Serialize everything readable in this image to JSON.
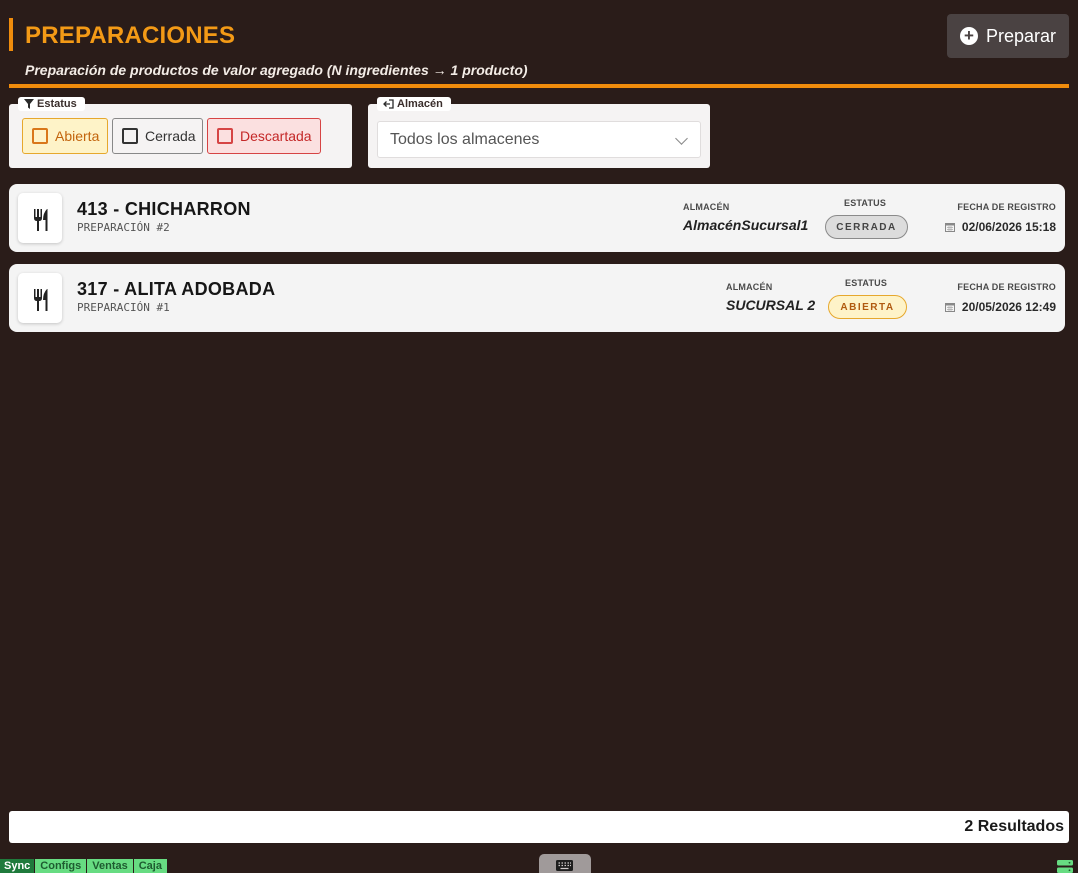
{
  "header": {
    "title": "PREPARACIONES",
    "subtitle": "Preparación de productos de valor agregado (N ingredientes → 1 producto)",
    "prepare_button": "Preparar"
  },
  "filters": {
    "status": {
      "legend": "Estatus",
      "options": [
        {
          "label": "Abierta",
          "checked": false
        },
        {
          "label": "Cerrada",
          "checked": false
        },
        {
          "label": "Descartada",
          "checked": false
        }
      ]
    },
    "warehouse": {
      "legend": "Almacén",
      "selected": "Todos los almacenes"
    }
  },
  "labels": {
    "warehouse": "ALMACÉN",
    "status": "ESTATUS",
    "date": "FECHA DE REGISTRO"
  },
  "rows": [
    {
      "title": "413 - CHICHARRON",
      "subtitle": "PREPARACIÓN #2",
      "warehouse": "AlmacénSucursal1",
      "status": "CERRADA",
      "date": "02/06/2026 15:18",
      "icon": "utensils-icon"
    },
    {
      "title": "317 - ALITA ADOBADA",
      "subtitle": "PREPARACIÓN #1",
      "warehouse": "SUCURSAL 2",
      "status": "ABIERTA",
      "date": "20/05/2026 12:49",
      "icon": "utensils-icon"
    }
  ],
  "footer": {
    "results": "2 Resultados"
  },
  "status_bar": {
    "tabs": [
      "Sync",
      "Configs",
      "Ventas",
      "Caja"
    ]
  },
  "colors": {
    "accent": "#f08c0c",
    "background": "#2a1c19",
    "open": "#e6a82d",
    "discarded": "#d64444",
    "sync_ok": "#67dc82"
  }
}
